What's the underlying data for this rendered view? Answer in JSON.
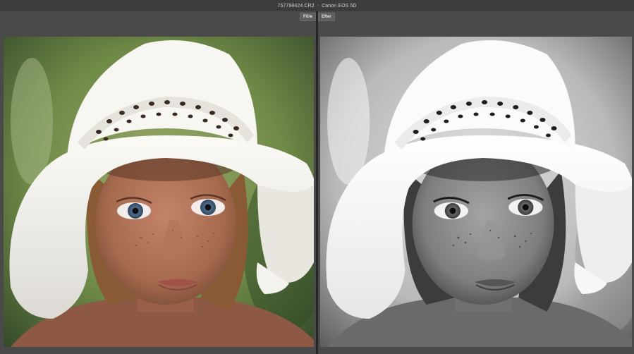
{
  "window": {
    "filename": "757798424.CR2",
    "separator": "-",
    "camera": "Canon EOS 5D"
  },
  "compare": {
    "before_label": "Före",
    "after_label": "Efter"
  },
  "colors": {
    "panel_bg": "#4a4a4a",
    "titlebar_bg": "#3c3c3c",
    "label_bg": "#5e5e5e",
    "hat_white": "#f1f0ec",
    "skin": "#a56a4e",
    "eye_blue": "#3d5a78",
    "background_green": "#6f8a47"
  }
}
